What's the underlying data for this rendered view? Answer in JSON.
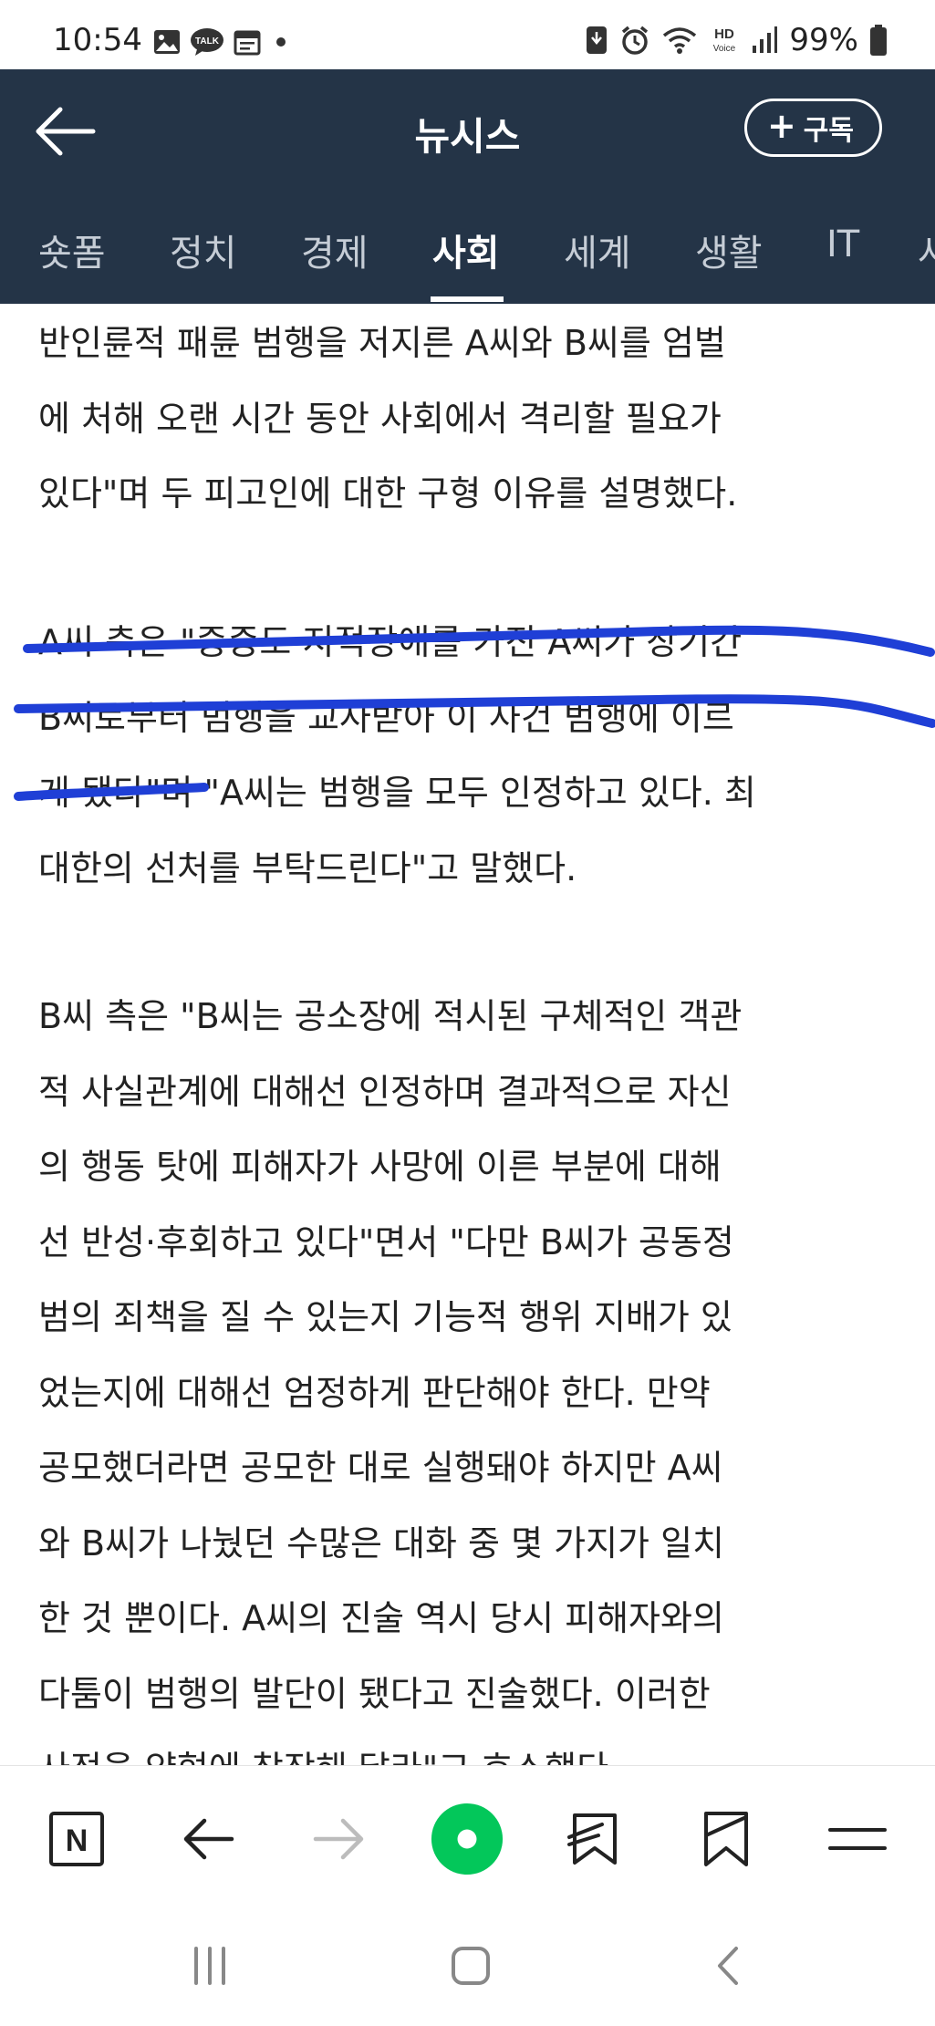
{
  "status_bar": {
    "time": "10:54",
    "battery": "99%",
    "left_icons": [
      "image-icon",
      "talk-icon",
      "calendar-icon",
      "dot-icon"
    ],
    "right_icons": [
      "download-icon",
      "alarm-icon",
      "wifi-icon",
      "hd-voice-icon",
      "signal-icon",
      "battery-icon"
    ],
    "talk_badge": "TALK",
    "hd_label": "HD",
    "voice_label": "Voice"
  },
  "header": {
    "title": "뉴시스",
    "subscribe_label": "구독",
    "subscribe_plus": "+",
    "background": "#243447"
  },
  "tabs": [
    {
      "label": "숏폼"
    },
    {
      "label": "정치"
    },
    {
      "label": "경제"
    },
    {
      "label": "사회",
      "active": true
    },
    {
      "label": "세계"
    },
    {
      "label": "생활"
    },
    {
      "label": "IT"
    },
    {
      "label": "사"
    }
  ],
  "article": {
    "paragraphs": [
      {
        "lines": [
          "반인륜적 패륜 범행을 저지른 A씨와 B씨를 엄벌",
          "에 처해 오랜 시간 동안 사회에서 격리할 필요가",
          "있다\"며 두 피고인에 대한 구형 이유를 설명했다."
        ]
      },
      {
        "lines": [
          "A씨 측은 \"중증도 지적장애를 가진 A씨가 장기간",
          "B씨로부터 범행을 교사받아 이 사건 범행에 이르",
          "게 됐다\"며 \"A씨는 범행을 모두 인정하고 있다. 최",
          "대한의 선처를 부탁드린다\"고 말했다."
        ]
      },
      {
        "lines": [
          "B씨 측은 \"B씨는 공소장에 적시된 구체적인 객관",
          "적 사실관계에 대해선 인정하며 결과적으로 자신",
          "의 행동 탓에 피해자가 사망에 이른 부분에 대해",
          "선 반성·후회하고 있다\"면서 \"다만 B씨가 공동정",
          "범의 죄책을 질 수 있는지 기능적 행위 지배가 있",
          "었는지에 대해선 엄정하게 판단해야 한다. 만약",
          "공모했더라면 공모한 대로 실행돼야 하지만 A씨",
          "와 B씨가 나눴던 수많은 대화 중 몇 가지가 일치",
          "한 것 뿐이다. A씨의 진술 역시 당시 피해자와의",
          "다툼이 범행의 발단이 됐다고 진술했다. 이러한",
          "사정을 양형에 참작해 달라\"고 호소했다."
        ]
      }
    ],
    "highlight_color": "#1f3fd6"
  },
  "toolbar": {
    "naver_label": "N",
    "items": [
      "naver-home-icon",
      "back-arrow-icon",
      "forward-arrow-icon",
      "green-dot-icon",
      "share-icon",
      "bookmark-icon",
      "menu-icon"
    ],
    "green_color": "#03c75a"
  },
  "nav": {
    "items": [
      "recent-apps-icon",
      "home-icon",
      "back-icon"
    ]
  }
}
